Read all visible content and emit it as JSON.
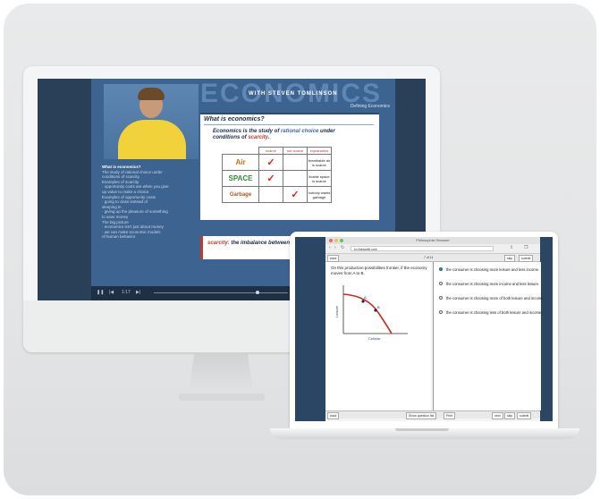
{
  "imac": {
    "banner_word": "ECONOMICS",
    "banner_subtitle": "WITH STEVEN TOMLINSON",
    "banner_section": "Defining Economics",
    "slide_title": "What is economics?",
    "slide_text_1": "Economics is the study of ",
    "slide_text_link": "rational choice",
    "slide_text_2": " under conditions of ",
    "slide_text_emph": "scarcity",
    "slide_text_end": ".",
    "table_headers": [
      "scarce",
      "not scarce",
      "explanation"
    ],
    "table_rows": [
      {
        "label": "Air",
        "explanation": "breathable air is scarce"
      },
      {
        "label": "SPACE",
        "explanation": "livable space is scarce"
      },
      {
        "label": "Garbage",
        "explanation": "nobody wants garbage"
      }
    ],
    "notes_heading": "What is economics?",
    "notes_lines": [
      "The study of rational choice under",
      "conditions of scarcity.",
      "Examples of scarcity",
      "· opportunity costs are when you give",
      "  up value to make a choice",
      "Examples of opportunity costs",
      "· going to class instead of",
      "  sleeping in",
      "· giving up the pleasure of something",
      "  to save money",
      "The big picture",
      "· economics isn't just about money",
      "· we can make economic models",
      "  of human behavior"
    ],
    "caption_term": "scarcity:",
    "caption_text": " the imbalance between th... people want and the amou...",
    "time": "1:17"
  },
  "laptop": {
    "window_title": "Philosophie/ Browser",
    "url": "ec.thinkwell.com",
    "toolbar_left": "back",
    "toolbar_center": "7 of 11",
    "toolbar_right": [
      "skip",
      "submit"
    ],
    "question": "On this production possibilities frontier, if the economy moves from A to B,",
    "graph_ylabel": "Leisure",
    "graph_xlabel": "Cellular",
    "point_a": "A",
    "point_b": "B",
    "options": [
      "the consumer is choosing more leisure and less income.",
      "the consumer is choosing more income and less leisure.",
      "the consumer is choosing more of both leisure and income.",
      "the consumer is choosing less of both leisure and income."
    ],
    "bottom_left": "back",
    "bottom_mid": [
      "Show question list",
      "Print"
    ],
    "bottom_right": [
      "next",
      "skip",
      "submit"
    ]
  },
  "colors": {
    "screen_blue": "#3d6390",
    "dark_blue": "#2a3f58",
    "accent_red": "#c23a2a",
    "curve_red": "#d0281c"
  }
}
